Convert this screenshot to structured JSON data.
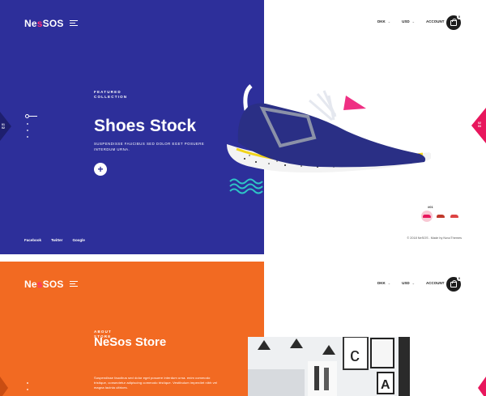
{
  "hero": {
    "brand": {
      "logo_left": "Ne",
      "logo_dot": "s",
      "logo_right": "SOS"
    },
    "nav": {
      "currency_a": "DKK",
      "currency_b": "USD",
      "account": "ACCOUNT",
      "cart_count": "0"
    },
    "eyebrow": {
      "line1": "FEATURED",
      "line2": "COLLECTION"
    },
    "title": "Shoes Stock",
    "subtitle": "SUSPENDISSE FAUCIBUS SED DOLOR EGET POSUERE INTERDUM URNA.",
    "plus_label": "+",
    "left_tab": {
      "line1": "01",
      "line2": "02"
    },
    "right_tab": {
      "line1": "02",
      "line2": "03"
    },
    "social": [
      "Facebook",
      "Twitter",
      "Google"
    ],
    "copyright": "© 2018 NeSOS . Made by NovoThemes",
    "thumb_counter": "#01",
    "colors": {
      "panel": "#2d2f9a",
      "accent_pink": "#e8175d",
      "accent_teal": "#2ec4c6",
      "sole_yellow": "#f1d41a"
    }
  },
  "about": {
    "brand": {
      "logo_left": "Ne",
      "logo_dot": "s",
      "logo_right": "SOS"
    },
    "nav": {
      "currency_a": "DKK",
      "currency_b": "USD",
      "account": "ACCOUNT",
      "cart_count": "0"
    },
    "eyebrow": {
      "line1": "ABOUT",
      "line2": "STORE"
    },
    "title": "NeSos Store",
    "body": "Suspendisse faucibus sed dolor eget posuere interdum urna. enim commodo tristique, consectetur adipiscing commodo tristique. Vestibulum imperdiet nibh vel magna lacinia ultrices.",
    "colors": {
      "panel": "#f26a22"
    }
  }
}
